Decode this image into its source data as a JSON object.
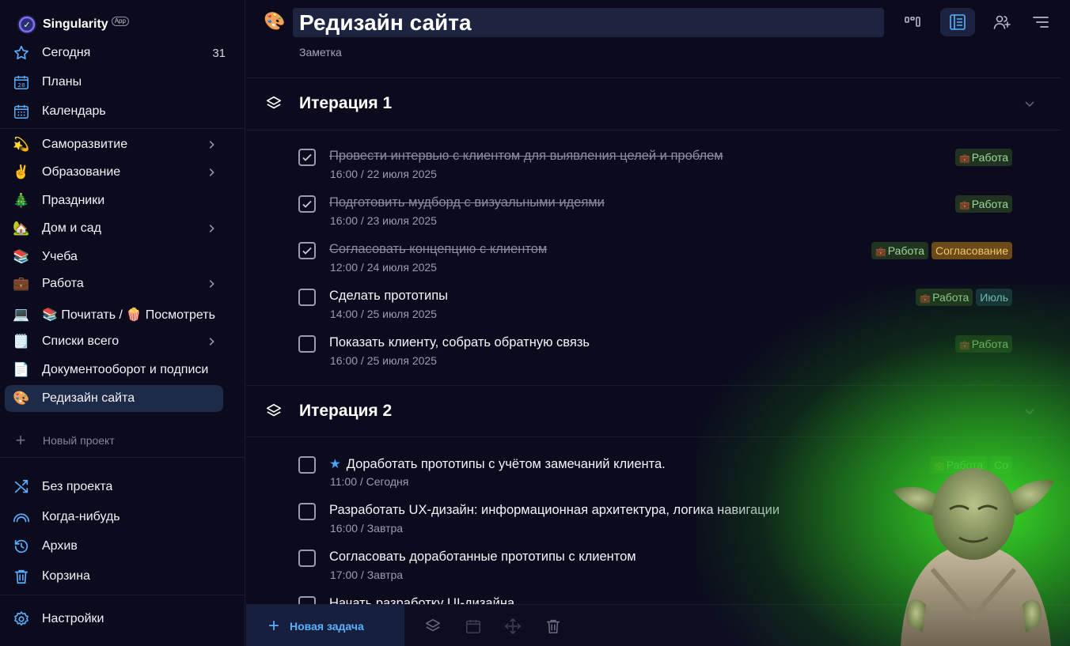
{
  "brand": {
    "name": "Singularity",
    "badge": "App"
  },
  "sidebar": {
    "top_items": [
      {
        "label": "Сегодня",
        "count": "31",
        "icon": "star-icon"
      },
      {
        "label": "Планы",
        "icon": "calendar-day-icon"
      },
      {
        "label": "Календарь",
        "icon": "calendar-grid-icon"
      }
    ],
    "projects": [
      {
        "label": "Саморазвитие",
        "emoji": "💫",
        "has_children": true
      },
      {
        "label": "Образование",
        "emoji": "✌️",
        "has_children": true
      },
      {
        "label": "Праздники",
        "emoji": "🎄",
        "has_children": false
      },
      {
        "label": "Дом и сад",
        "emoji": "🏡",
        "has_children": true
      },
      {
        "label": "Учеба",
        "emoji": "📚",
        "has_children": false
      },
      {
        "label": "Работа",
        "emoji": "💼",
        "has_children": true
      },
      {
        "label": "📚 Почитать / 🍿 Посмотреть",
        "emoji": "💻",
        "has_children": false
      },
      {
        "label": "Списки всего",
        "emoji": "🗒️",
        "has_children": true
      },
      {
        "label": "Документооборот и подписи",
        "emoji": "📄",
        "has_children": false
      },
      {
        "label": "Редизайн сайта",
        "emoji": "🎨",
        "has_children": false,
        "active": true
      }
    ],
    "new_project_label": "Новый проект",
    "bottom_items": [
      {
        "label": "Без проекта",
        "icon": "shuffle-icon"
      },
      {
        "label": "Когда-нибудь",
        "icon": "rainbow-icon"
      },
      {
        "label": "Архив",
        "icon": "history-icon"
      },
      {
        "label": "Корзина",
        "icon": "trash-icon"
      }
    ],
    "settings_label": "Настройки"
  },
  "header": {
    "emoji": "🎨",
    "title": "Редизайн сайта",
    "subtitle": "Заметка"
  },
  "sections": [
    {
      "title": "Итерация 1",
      "tasks": [
        {
          "title": "Провести интервью с клиентом для выявления целей и проблем",
          "date": "16:00 / 22 июля 2025",
          "done": true,
          "tags": [
            "Работа"
          ]
        },
        {
          "title": "Подготовить мудборд с визуальными идеями",
          "date": "16:00 / 23 июля 2025",
          "done": true,
          "tags": [
            "Работа"
          ]
        },
        {
          "title": "Согласовать концепцию с клиентом",
          "date": "12:00 / 24 июля 2025",
          "done": true,
          "tags": [
            "Работа",
            "Согласование"
          ]
        },
        {
          "title": "Сделать прототипы",
          "date": "14:00 / 25 июля 2025",
          "done": false,
          "tags": [
            "Работа",
            "Июль"
          ]
        },
        {
          "title": "Показать клиенту, собрать обратную связь",
          "date": "16:00 / 25 июля 2025",
          "done": false,
          "tags": [
            "Работа"
          ]
        }
      ]
    },
    {
      "title": "Итерация 2",
      "tasks": [
        {
          "title": "Доработать прототипы с учётом замечаний клиента.",
          "date": "11:00 / Сегодня",
          "done": false,
          "starred": true,
          "tags": [
            "Работа",
            "Со"
          ]
        },
        {
          "title": "Разработать UX-дизайн: информационная архитектура, логика навигации",
          "date": "16:00 / Завтра",
          "done": false,
          "tags": []
        },
        {
          "title": "Согласовать доработанные прототипы с клиентом",
          "date": "17:00 / Завтра",
          "done": false,
          "tags": []
        },
        {
          "title": "Начать разработку UI-дизайна",
          "date": "",
          "done": false,
          "tags": []
        }
      ]
    }
  ],
  "bottom_bar": {
    "new_task_label": "Новая задача"
  },
  "colors": {
    "accent": "#5ab0ff",
    "work_tag": "#9fd89a",
    "agree_tag": "#f6c46a",
    "july_tag": "#7fc6cf"
  }
}
